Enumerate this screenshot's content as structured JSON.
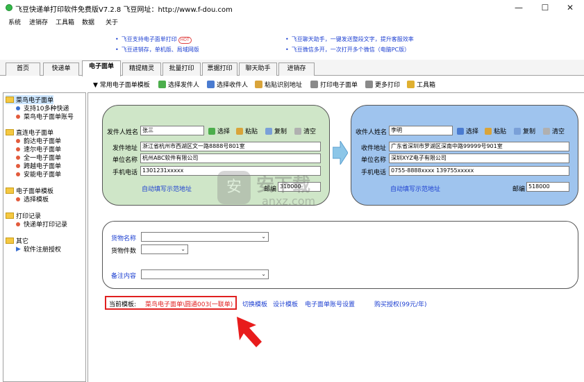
{
  "window": {
    "title": "飞豆快递单打印软件免费版V7.2.8  飞豆网址：http://www.f-dou.com",
    "minimize": "—",
    "maximize": "☐",
    "close": "✕"
  },
  "menu": [
    "系统",
    "进销存",
    "工具箱",
    "数据",
    "关于"
  ],
  "ads": [
    {
      "text": "飞豆支持电子面单打印",
      "hot": "HOT"
    },
    {
      "text": "飞豆进销存，单机版、局域网版"
    },
    {
      "text": "飞豆聊天助手，一键发送整段文字，提升客服效率"
    },
    {
      "text": "飞豆微信多开，一次打开多个微信（电脑PC版）"
    }
  ],
  "tabs": [
    "首页",
    "快递单",
    "电子面单",
    "精提精灵",
    "批量打印",
    "票据打印",
    "聊天助手",
    "进销存"
  ],
  "toolbar": [
    "▼ 常用电子面单模板",
    "选择发件人",
    "选择收件人",
    "粘贴识别地址",
    "打印电子面单",
    "更多打印",
    "工具箱"
  ],
  "sidebar": {
    "groups": [
      {
        "label": "菜鸟电子面单",
        "items": [
          "支持10多种快递",
          "菜鸟电子面单账号"
        ]
      },
      {
        "label": "直连电子面单",
        "items": [
          "韵达电子面单",
          "速尔电子面单",
          "全一电子面单",
          "跨越电子面单",
          "安能电子面单"
        ]
      },
      {
        "label": "电子面单模板",
        "items": [
          "选择模板"
        ]
      },
      {
        "label": "打印记录",
        "items": [
          "快递单打印记录"
        ]
      },
      {
        "label": "其它",
        "items": [
          "软件注册授权"
        ]
      }
    ]
  },
  "sender": {
    "name_label": "发件人姓名",
    "name_value": "张三",
    "address_label": "发件地址",
    "address_value": "浙江省杭州市西湖区文一路8888号801室",
    "company_label": "单位名称",
    "company_value": "杭州ABC软件有限公司",
    "phone_label": "手机电话",
    "phone_value": "1301231xxxxx",
    "postcode_label": "邮编",
    "postcode_value": "310000",
    "autofill_link": "自动填写示范地址",
    "actions": [
      "选择",
      "粘贴",
      "复制",
      "清空"
    ]
  },
  "receiver": {
    "name_label": "收件人姓名",
    "name_value": "李明",
    "address_label": "收件地址",
    "address_value": "广东省深圳市罗湖区深南中路99999号901室",
    "company_label": "单位名称",
    "company_value": "深圳XYZ电子有限公司",
    "phone_label": "手机电话",
    "phone_value": "0755-8888xxxx  139755xxxxx",
    "postcode_label": "邮编",
    "postcode_value": "518000",
    "autofill_link": "自动填写示范地址",
    "actions": [
      "选择",
      "粘贴",
      "复制",
      "清空"
    ]
  },
  "goods": {
    "name_label": "货物名称",
    "count_label": "货物件数",
    "remark_label": "备注内容"
  },
  "bottom": {
    "template_label": "当前模板:",
    "template_value": "菜鸟电子面单\\圆通003(一联单)",
    "switch_template": "切换模板",
    "design_template": "设计模板",
    "account_settings": "电子面单账号设置",
    "buy_license": "购买授权(99元/年)"
  },
  "watermark": {
    "text": "安下载",
    "sub": "anxz.com"
  },
  "colors": {
    "sender_panel": "#cfe6c8",
    "receiver_panel": "#9fc4ee",
    "arrow": "#8cc6e8",
    "link": "#1c3fd1",
    "highlight": "#e02020"
  }
}
